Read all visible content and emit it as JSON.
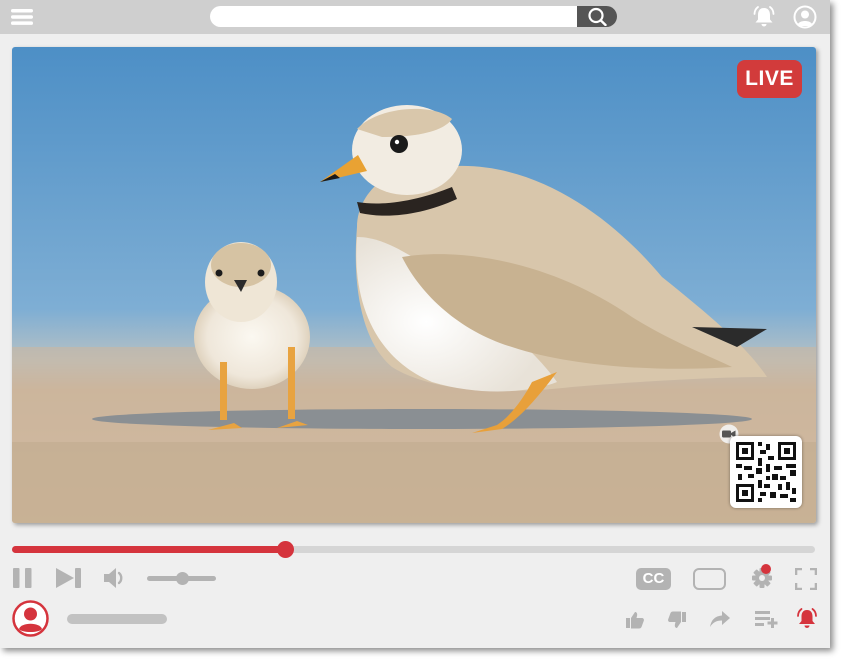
{
  "search": {
    "value": "",
    "placeholder": ""
  },
  "video": {
    "live_label": "LIVE"
  },
  "player": {
    "progress_fraction": 0.34,
    "volume_fraction": 0.5,
    "cc_label": "CC"
  },
  "channel": {
    "name": ""
  },
  "icons": {
    "menu": "menu-icon",
    "search": "search-icon",
    "notifications": "bell-icon",
    "account": "account-icon",
    "pause": "pause-icon",
    "next": "skip-next-icon",
    "volume": "volume-icon",
    "settings": "gear-icon",
    "fullscreen": "fullscreen-icon",
    "like": "thumbs-up-icon",
    "dislike": "thumbs-down-icon",
    "share": "share-icon",
    "playlist": "playlist-add-icon",
    "subscribe_bell": "bell-ring-icon"
  },
  "colors": {
    "accent": "#d5343d",
    "live_badge": "#d23b3b",
    "chrome": "#efefef",
    "topbar": "#cfcfcf",
    "icon": "#b3b3b3"
  }
}
